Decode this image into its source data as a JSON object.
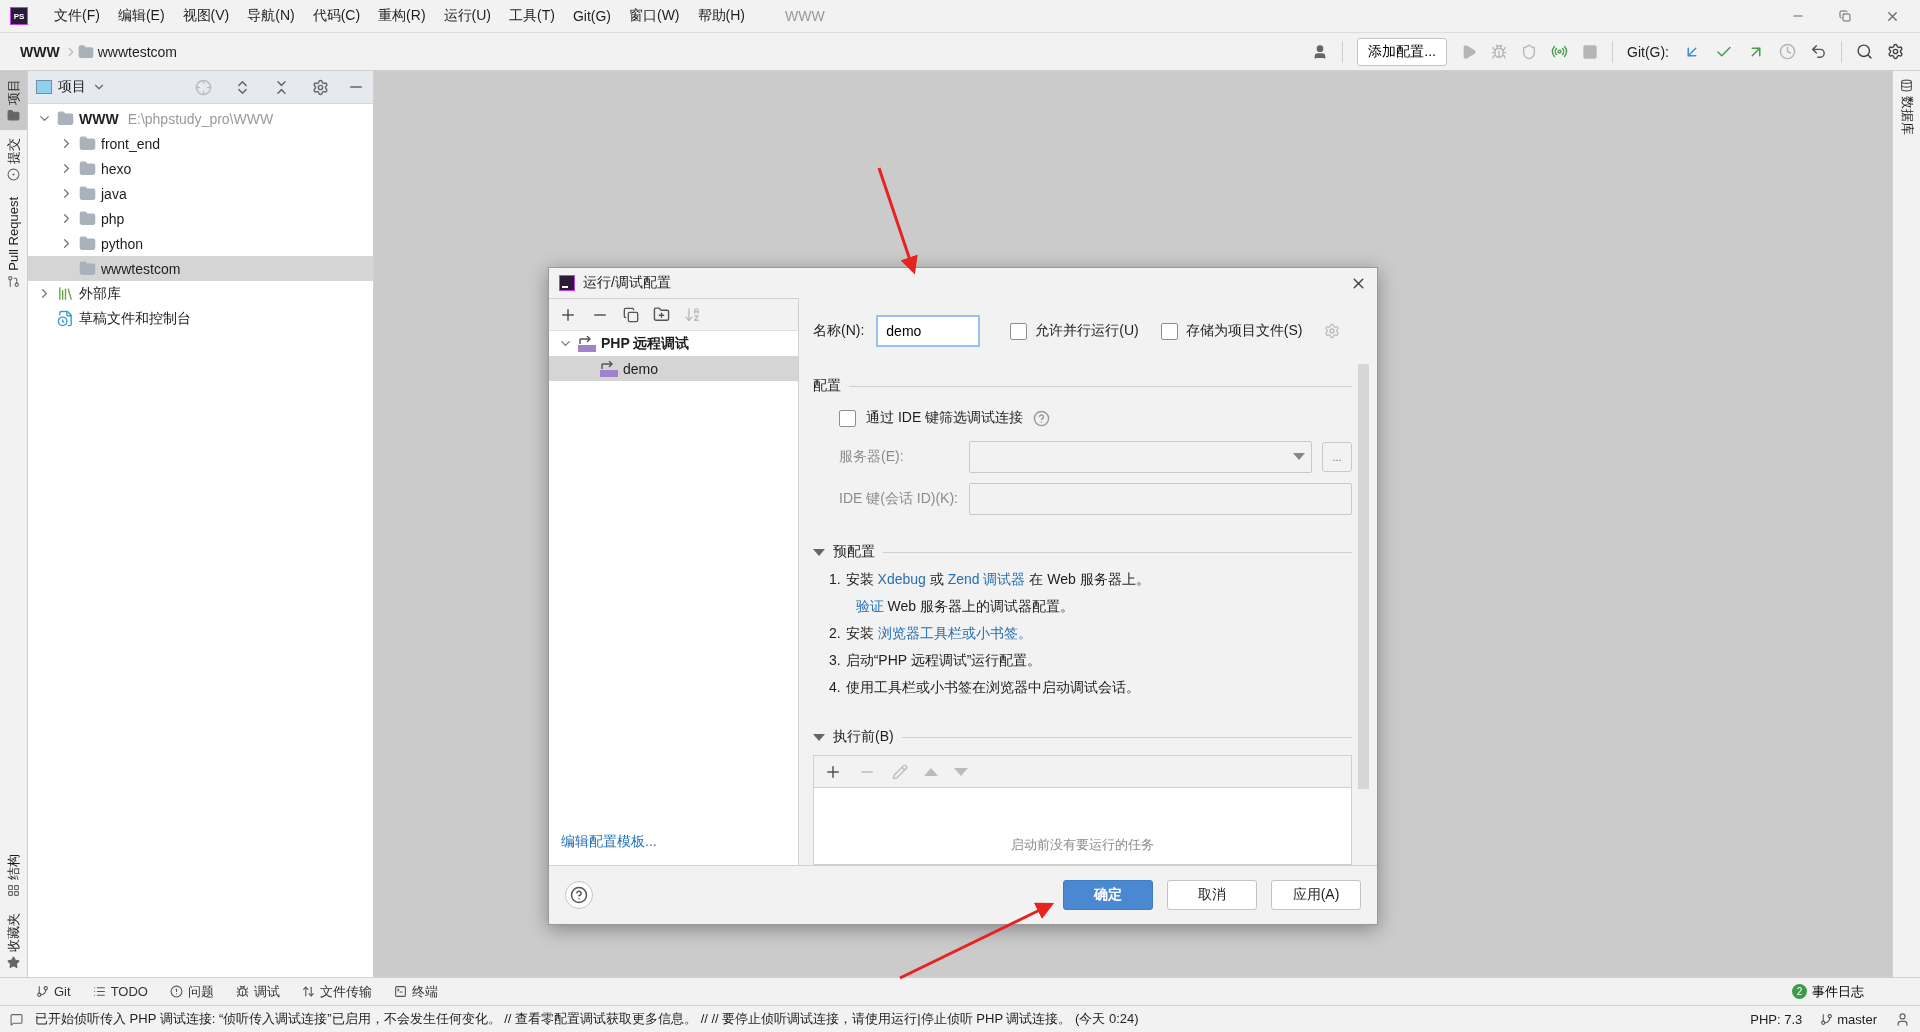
{
  "app": {
    "logo": "PS",
    "project_title": "WWW",
    "menu": [
      "文件(F)",
      "编辑(E)",
      "视图(V)",
      "导航(N)",
      "代码(C)",
      "重构(R)",
      "运行(U)",
      "工具(T)",
      "Git(G)",
      "窗口(W)",
      "帮助(H)"
    ]
  },
  "breadcrumb": [
    "WWW",
    "wwwtestcom"
  ],
  "toolbar": {
    "run_config_button": "添加配置...",
    "git_label": "Git(G):"
  },
  "left_stripe_top": [
    {
      "label": "项目",
      "selected": true,
      "kind": "folder"
    },
    {
      "label": "提交",
      "selected": false,
      "kind": "commit"
    },
    {
      "label": "Pull Request",
      "selected": false,
      "kind": "pull"
    }
  ],
  "left_stripe_bottom": [
    {
      "label": "结构",
      "selected": false,
      "kind": "structure"
    },
    {
      "label": "收藏夹",
      "selected": false,
      "kind": "star"
    }
  ],
  "right_stripe": [
    {
      "label": "数据库",
      "selected": false
    }
  ],
  "project_panel": {
    "title": "项目",
    "tree": [
      {
        "label": "WWW",
        "path": "E:\\phpstudy_pro\\WWW",
        "kind": "folder",
        "expanded": true,
        "selected": false,
        "children": [
          {
            "label": "front_end",
            "kind": "folder",
            "expanded": false,
            "selected": false
          },
          {
            "label": "hexo",
            "kind": "folder",
            "expanded": false,
            "selected": false
          },
          {
            "label": "java",
            "kind": "folder",
            "expanded": false,
            "selected": false
          },
          {
            "label": "php",
            "kind": "folder",
            "expanded": false,
            "selected": false
          },
          {
            "label": "python",
            "kind": "folder",
            "expanded": false,
            "selected": false
          },
          {
            "label": "wwwtestcom",
            "kind": "folder",
            "selected": true
          }
        ]
      },
      {
        "label": "外部库",
        "kind": "library",
        "expanded": false,
        "selected": false
      },
      {
        "label": "草稿文件和控制台",
        "kind": "scratch",
        "selected": false
      }
    ]
  },
  "dialog": {
    "title": "运行/调试配置",
    "tree": [
      {
        "label": "PHP 远程调试",
        "expanded": true,
        "selected": false,
        "children": [
          {
            "label": "demo",
            "selected": true
          }
        ]
      }
    ],
    "edit_templates_link": "编辑配置模板...",
    "name_label": "名称(N):",
    "name_value": "demo",
    "options": [
      {
        "label": "允许并行运行(U)",
        "checked": false
      },
      {
        "label": "存储为项目文件(S)",
        "checked": false
      }
    ],
    "config_section": {
      "title": "配置",
      "filter_checkbox": {
        "label": "通过 IDE 键筛选调试连接",
        "checked": false
      },
      "fields": [
        {
          "label": "服务器(E):",
          "kind": "dropdown",
          "disabled": true,
          "browse_button": "..."
        },
        {
          "label": "IDE 键(会话 ID)(K):",
          "kind": "text",
          "disabled": true
        }
      ]
    },
    "preconfig": {
      "title": "预配置",
      "expanded": true,
      "steps": [
        {
          "number": "1.",
          "lines": [
            [
              {
                "text": "安装 "
              },
              {
                "text": "Xdebug",
                "link": true
              },
              {
                "text": " 或 "
              },
              {
                "text": "Zend 调试器",
                "link": true
              },
              {
                "text": " 在 Web 服务器上。"
              }
            ],
            [
              {
                "text": "验证",
                "link": true
              },
              {
                "text": " Web 服务器上的调试器配置。"
              }
            ]
          ]
        },
        {
          "number": "2.",
          "lines": [
            [
              {
                "text": "安装 "
              },
              {
                "text": "浏览器工具栏或小书签。",
                "link": true
              }
            ]
          ]
        },
        {
          "number": "3.",
          "lines": [
            [
              {
                "text": "启动“PHP 远程调试”运行配置。"
              }
            ]
          ]
        },
        {
          "number": "4.",
          "lines": [
            [
              {
                "text": "使用工具栏或小书签在浏览器中启动调试会话。"
              }
            ]
          ]
        }
      ]
    },
    "before_launch": {
      "title": "执行前(B)",
      "expanded": true,
      "empty_text": "启动前没有要运行的任务"
    },
    "buttons": [
      {
        "label": "确定",
        "kind": "primary"
      },
      {
        "label": "取消",
        "kind": "secondary"
      },
      {
        "label": "应用(A)",
        "kind": "secondary"
      }
    ]
  },
  "tool_windows": [
    {
      "label": "Git",
      "kind": "git"
    },
    {
      "label": "TODO",
      "kind": "todo"
    },
    {
      "label": "问题",
      "kind": "problems"
    },
    {
      "label": "调试",
      "kind": "debug"
    },
    {
      "label": "文件传输",
      "kind": "transfer"
    },
    {
      "label": "终端",
      "kind": "terminal"
    }
  ],
  "event_log": {
    "count": "2",
    "label": "事件日志"
  },
  "status_bar": {
    "message": "已开始侦听传入 PHP 调试连接: “侦听传入调试连接”已启用，不会发生任何变化。 // 查看零配置调试获取更多信息。 // // 要停止侦听调试连接，请使用运行|停止侦听 PHP 调试连接。 (今天 0:24)",
    "php": "PHP: 7.3",
    "branch": "master"
  }
}
